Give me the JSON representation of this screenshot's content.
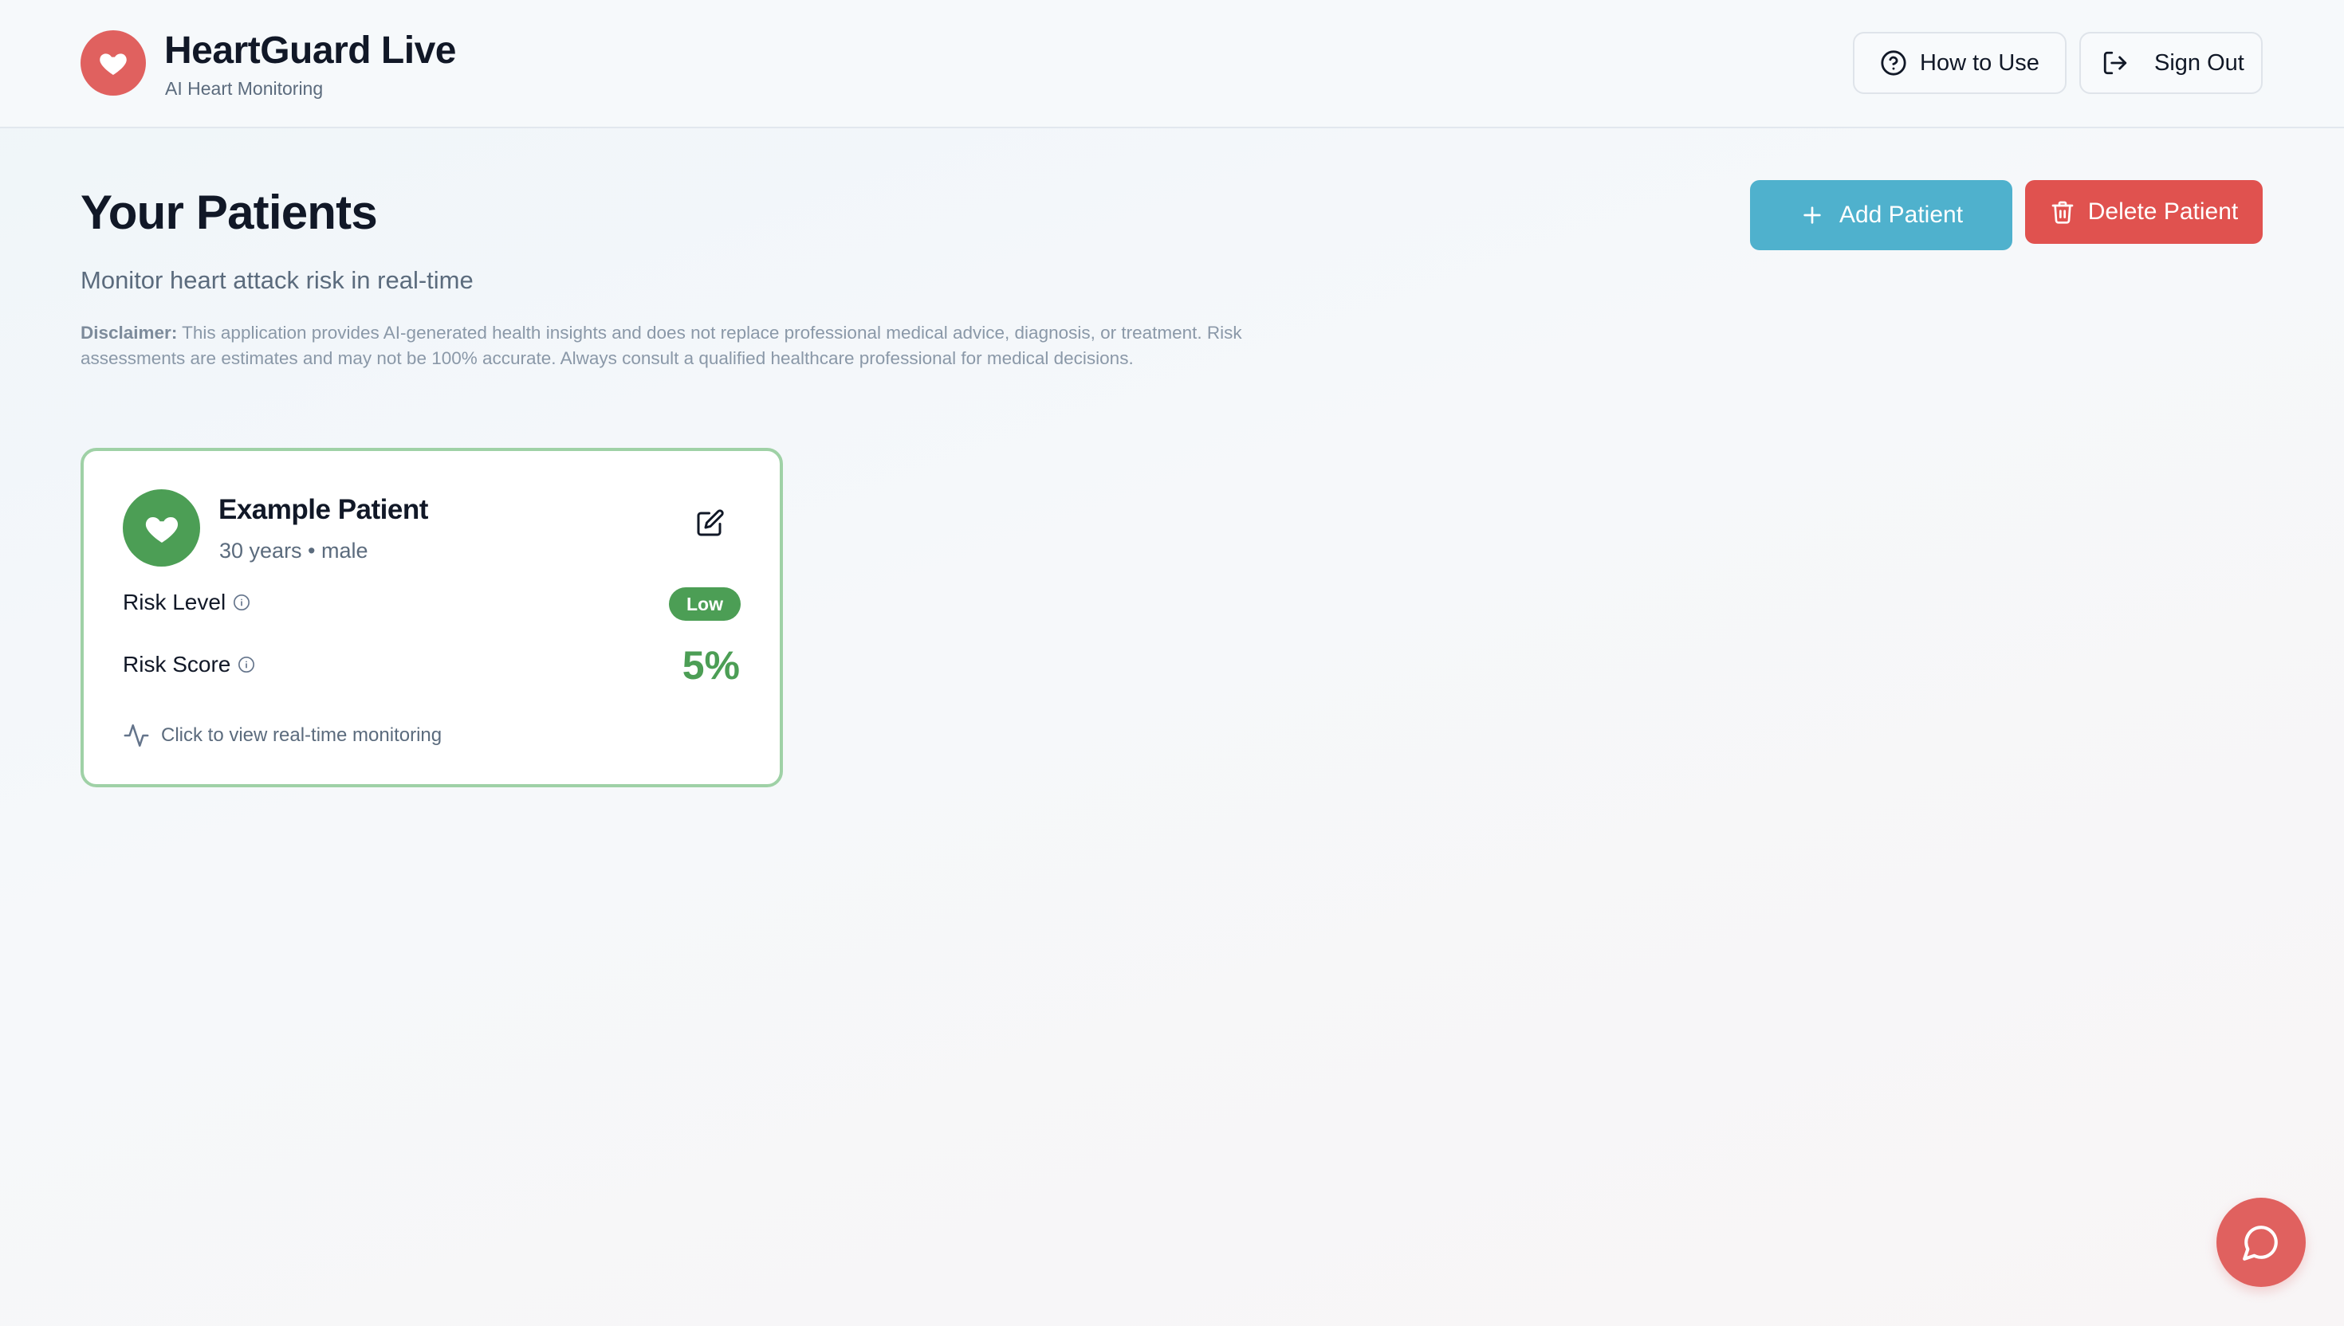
{
  "header": {
    "app_title": "HeartGuard Live",
    "app_subtitle": "AI Heart Monitoring",
    "how_to_use_label": "How to Use",
    "sign_out_label": "Sign Out"
  },
  "main": {
    "title": "Your Patients",
    "subtitle": "Monitor heart attack risk in real-time",
    "disclaimer_label": "Disclaimer:",
    "disclaimer_text": " This application provides AI-generated health insights and does not replace professional medical advice, diagnosis, or treatment. Risk assessments are estimates and may not be 100% accurate. Always consult a qualified healthcare professional for medical decisions.",
    "add_patient_label": "Add Patient",
    "delete_patient_label": "Delete Patient"
  },
  "patients": [
    {
      "name": "Example Patient",
      "meta": "30 years • male",
      "risk_level_label": "Risk Level",
      "risk_level": "Low",
      "risk_score_label": "Risk Score",
      "risk_score": "5%",
      "monitor_hint": "Click to view real-time monitoring"
    }
  ],
  "icons": {
    "logo": "heart-icon",
    "how_to_use": "help-circle-icon",
    "sign_out": "log-out-icon",
    "add": "plus-icon",
    "delete": "trash-icon",
    "edit": "edit-icon",
    "info": "info-icon",
    "activity": "activity-icon",
    "chat": "chat-bubble-icon"
  },
  "colors": {
    "brand_red": "#e0615f",
    "add_blue": "#4fb1cd",
    "delete_red": "#e0524f",
    "low_green": "#4c9e55",
    "card_border": "#9fd1a6"
  }
}
